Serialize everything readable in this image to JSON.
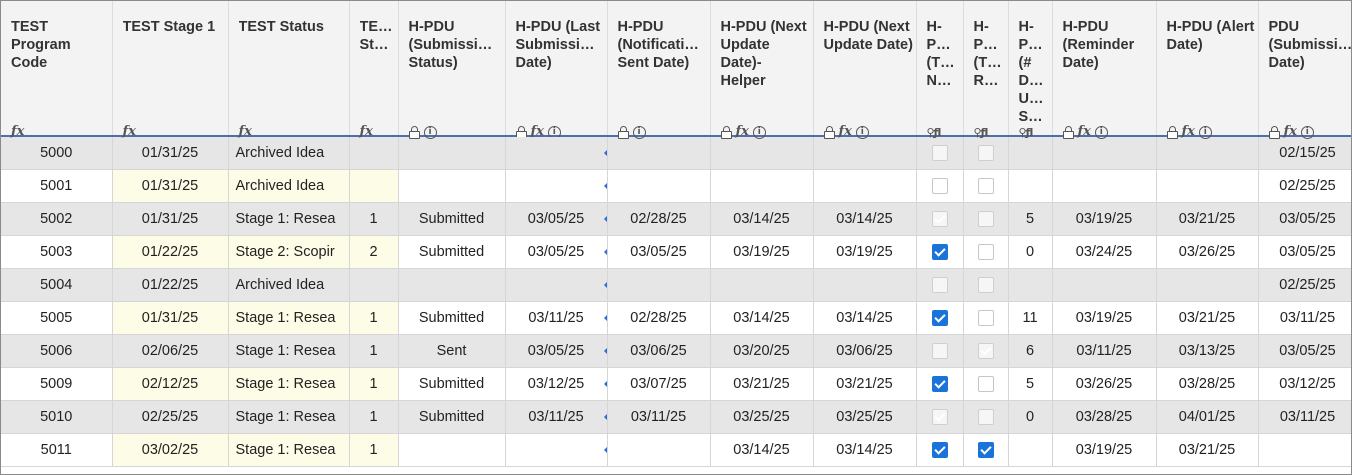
{
  "headers": [
    {
      "label": "TEST Program Code",
      "icons": [
        "fx"
      ]
    },
    {
      "label": "TEST Stage 1",
      "icons": [
        "fx"
      ]
    },
    {
      "label": "TEST Status",
      "icons": [
        "fx"
      ]
    },
    {
      "label": "TE… St…",
      "icons": [
        "fx"
      ]
    },
    {
      "label": "H-PDU (Submissi… Status)",
      "icons": [
        "lock",
        "info"
      ]
    },
    {
      "label": "H-PDU (Last Submissi… Date)",
      "icons": [
        "lock",
        "fx",
        "info"
      ]
    },
    {
      "label": "H-PDU (Notificati… Sent Date)",
      "icons": [
        "lock",
        "info"
      ]
    },
    {
      "label": "H-PDU (Next Update Date)- Helper",
      "icons": [
        "lock",
        "fx",
        "info"
      ]
    },
    {
      "label": "H-PDU (Next Update Date)",
      "icons": [
        "lock",
        "fx",
        "info"
      ]
    },
    {
      "label": "H- P… (T… N…",
      "icons": [
        "small"
      ]
    },
    {
      "label": "H- P… (T… R…",
      "icons": [
        "small"
      ]
    },
    {
      "label": "H- P… (# D… U… S…",
      "icons": [
        "small"
      ]
    },
    {
      "label": "H-PDU (Reminder Date)",
      "icons": [
        "lock",
        "fx",
        "info"
      ]
    },
    {
      "label": "H-PDU (Alert Date)",
      "icons": [
        "lock",
        "fx",
        "info"
      ]
    },
    {
      "label": "PDU (Submissi… Date)",
      "icons": [
        "lock",
        "fx",
        "info"
      ]
    }
  ],
  "rows": [
    {
      "code": "5000",
      "stage1": "01/31/25",
      "status": "Archived Idea",
      "st": "",
      "sub_status": "",
      "last_sub": "",
      "notif": "",
      "next_helper": "",
      "next": "",
      "cb1": false,
      "cb2": false,
      "days": "",
      "reminder": "",
      "alert": "",
      "pdu_sub": "02/15/25"
    },
    {
      "code": "5001",
      "stage1": "01/31/25",
      "status": "Archived Idea",
      "st": "",
      "sub_status": "",
      "last_sub": "",
      "notif": "",
      "next_helper": "",
      "next": "",
      "cb1": false,
      "cb2": false,
      "days": "",
      "reminder": "",
      "alert": "",
      "pdu_sub": "02/25/25"
    },
    {
      "code": "5002",
      "stage1": "01/31/25",
      "status": "Stage 1: Resea",
      "st": "1",
      "sub_status": "Submitted",
      "last_sub": "03/05/25",
      "notif": "02/28/25",
      "next_helper": "03/14/25",
      "next": "03/14/25",
      "cb1": true,
      "cb2": false,
      "days": "5",
      "reminder": "03/19/25",
      "alert": "03/21/25",
      "pdu_sub": "03/05/25"
    },
    {
      "code": "5003",
      "stage1": "01/22/25",
      "status": "Stage 2: Scopir",
      "st": "2",
      "sub_status": "Submitted",
      "last_sub": "03/05/25",
      "notif": "03/05/25",
      "next_helper": "03/19/25",
      "next": "03/19/25",
      "cb1": true,
      "cb2": false,
      "days": "0",
      "reminder": "03/24/25",
      "alert": "03/26/25",
      "pdu_sub": "03/05/25"
    },
    {
      "code": "5004",
      "stage1": "01/22/25",
      "status": "Archived Idea",
      "st": "",
      "sub_status": "",
      "last_sub": "",
      "notif": "",
      "next_helper": "",
      "next": "",
      "cb1": false,
      "cb2": false,
      "days": "",
      "reminder": "",
      "alert": "",
      "pdu_sub": "02/25/25"
    },
    {
      "code": "5005",
      "stage1": "01/31/25",
      "status": "Stage 1: Resea",
      "st": "1",
      "sub_status": "Submitted",
      "last_sub": "03/11/25",
      "notif": "02/28/25",
      "next_helper": "03/14/25",
      "next": "03/14/25",
      "cb1": true,
      "cb2": false,
      "days": "11",
      "reminder": "03/19/25",
      "alert": "03/21/25",
      "pdu_sub": "03/11/25"
    },
    {
      "code": "5006",
      "stage1": "02/06/25",
      "status": "Stage 1: Resea",
      "st": "1",
      "sub_status": "Sent",
      "last_sub": "03/05/25",
      "notif": "03/06/25",
      "next_helper": "03/20/25",
      "next": "03/06/25",
      "cb1": false,
      "cb2": true,
      "days": "6",
      "reminder": "03/11/25",
      "alert": "03/13/25",
      "pdu_sub": "03/05/25"
    },
    {
      "code": "5009",
      "stage1": "02/12/25",
      "status": "Stage 1: Resea",
      "st": "1",
      "sub_status": "Submitted",
      "last_sub": "03/12/25",
      "notif": "03/07/25",
      "next_helper": "03/21/25",
      "next": "03/21/25",
      "cb1": true,
      "cb2": false,
      "days": "5",
      "reminder": "03/26/25",
      "alert": "03/28/25",
      "pdu_sub": "03/12/25"
    },
    {
      "code": "5010",
      "stage1": "02/25/25",
      "status": "Stage 1: Resea",
      "st": "1",
      "sub_status": "Submitted",
      "last_sub": "03/11/25",
      "notif": "03/11/25",
      "next_helper": "03/25/25",
      "next": "03/25/25",
      "cb1": true,
      "cb2": false,
      "days": "0",
      "reminder": "03/28/25",
      "alert": "04/01/25",
      "pdu_sub": "03/11/25"
    },
    {
      "code": "5011",
      "stage1": "03/02/25",
      "status": "Stage 1: Resea",
      "st": "1",
      "sub_status": "",
      "last_sub": "",
      "notif": "",
      "next_helper": "03/14/25",
      "next": "03/14/25",
      "cb1": true,
      "cb2": true,
      "days": "",
      "reminder": "03/19/25",
      "alert": "03/21/25",
      "pdu_sub": ""
    }
  ],
  "colors": {
    "header_bg": "#f3f3f3",
    "row_gray": "#e6e6e6",
    "row_yellow": "#fdfce6",
    "checkbox_on": "#1a73d9",
    "header_rule": "#4d6fae"
  }
}
